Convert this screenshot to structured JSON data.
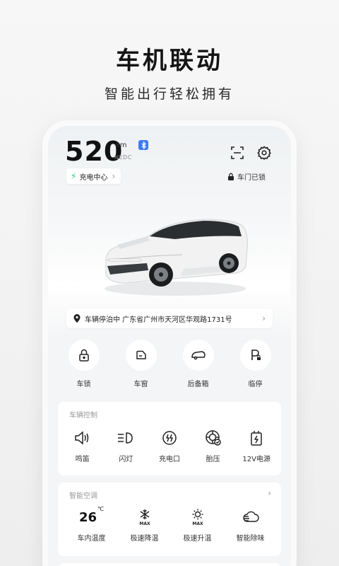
{
  "promo": {
    "title": "车机联动",
    "subtitle": "智能出行轻松拥有"
  },
  "vehicle": {
    "range_value": "520",
    "range_unit": "km",
    "range_standard": "NEDC",
    "bluetooth_icon": "bluetooth-icon",
    "charging_center_label": "充电中心",
    "door_status": "车门已锁",
    "location_label": "车辆停泊中 广东省广州市天河区华观路1731号"
  },
  "quick_actions": [
    {
      "label": "车锁",
      "icon": "lock-icon"
    },
    {
      "label": "车窗",
      "icon": "window-icon"
    },
    {
      "label": "后备箱",
      "icon": "trunk-icon"
    },
    {
      "label": "临停",
      "icon": "temp-parking-icon"
    }
  ],
  "vehicle_control": {
    "title": "车辆控制",
    "items": [
      {
        "label": "鸣笛",
        "icon": "horn-icon"
      },
      {
        "label": "闪灯",
        "icon": "headlight-icon"
      },
      {
        "label": "充电口",
        "icon": "charge-port-icon"
      },
      {
        "label": "胎压",
        "icon": "tire-pressure-icon"
      },
      {
        "label": "12V电源",
        "icon": "battery-12v-icon"
      }
    ]
  },
  "climate": {
    "title": "智能空调",
    "temperature": "26",
    "temperature_unit": "℃",
    "items": [
      {
        "label": "车内温度"
      },
      {
        "label": "极速降温",
        "icon": "max-cool-icon",
        "badge": "MAX"
      },
      {
        "label": "极速升温",
        "icon": "max-heat-icon",
        "badge": "MAX"
      },
      {
        "label": "智能除味",
        "icon": "deodorize-icon"
      }
    ]
  },
  "colors": {
    "accent_blue": "#3d7bf5",
    "charge_green": "#2ec96b",
    "car_body": "#f2f2f2"
  }
}
